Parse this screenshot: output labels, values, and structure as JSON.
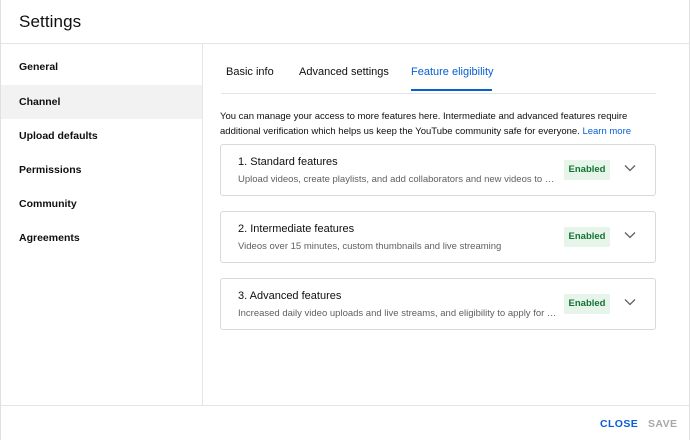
{
  "dialog": {
    "title": "Settings"
  },
  "sidebar": {
    "items": [
      {
        "label": "General"
      },
      {
        "label": "Channel",
        "active": true
      },
      {
        "label": "Upload defaults"
      },
      {
        "label": "Permissions"
      },
      {
        "label": "Community"
      },
      {
        "label": "Agreements"
      }
    ]
  },
  "tabs": [
    {
      "label": "Basic info"
    },
    {
      "label": "Advanced settings"
    },
    {
      "label": "Feature eligibility",
      "active": true
    }
  ],
  "intro": {
    "text": "You can manage your access to more features here. Intermediate and advanced features require additional verification which helps us keep the YouTube community safe for everyone.",
    "link": "Learn more"
  },
  "features": [
    {
      "title": "1. Standard features",
      "description": "Upload videos, create playlists, and add collaborators and new videos to pla...",
      "status": "Enabled"
    },
    {
      "title": "2. Intermediate features",
      "description": "Videos over 15 minutes, custom thumbnails and live streaming",
      "status": "Enabled"
    },
    {
      "title": "3. Advanced features",
      "description": "Increased daily video uploads and live streams, and eligibility to apply for m...",
      "status": "Enabled"
    }
  ],
  "footer": {
    "close_label": "CLOSE",
    "save_label": "SAVE"
  },
  "colors": {
    "accent": "#065fd4",
    "enabled_bg": "#e6f4ea",
    "enabled_text": "#137333",
    "disabled_text": "#a8a8a8"
  }
}
